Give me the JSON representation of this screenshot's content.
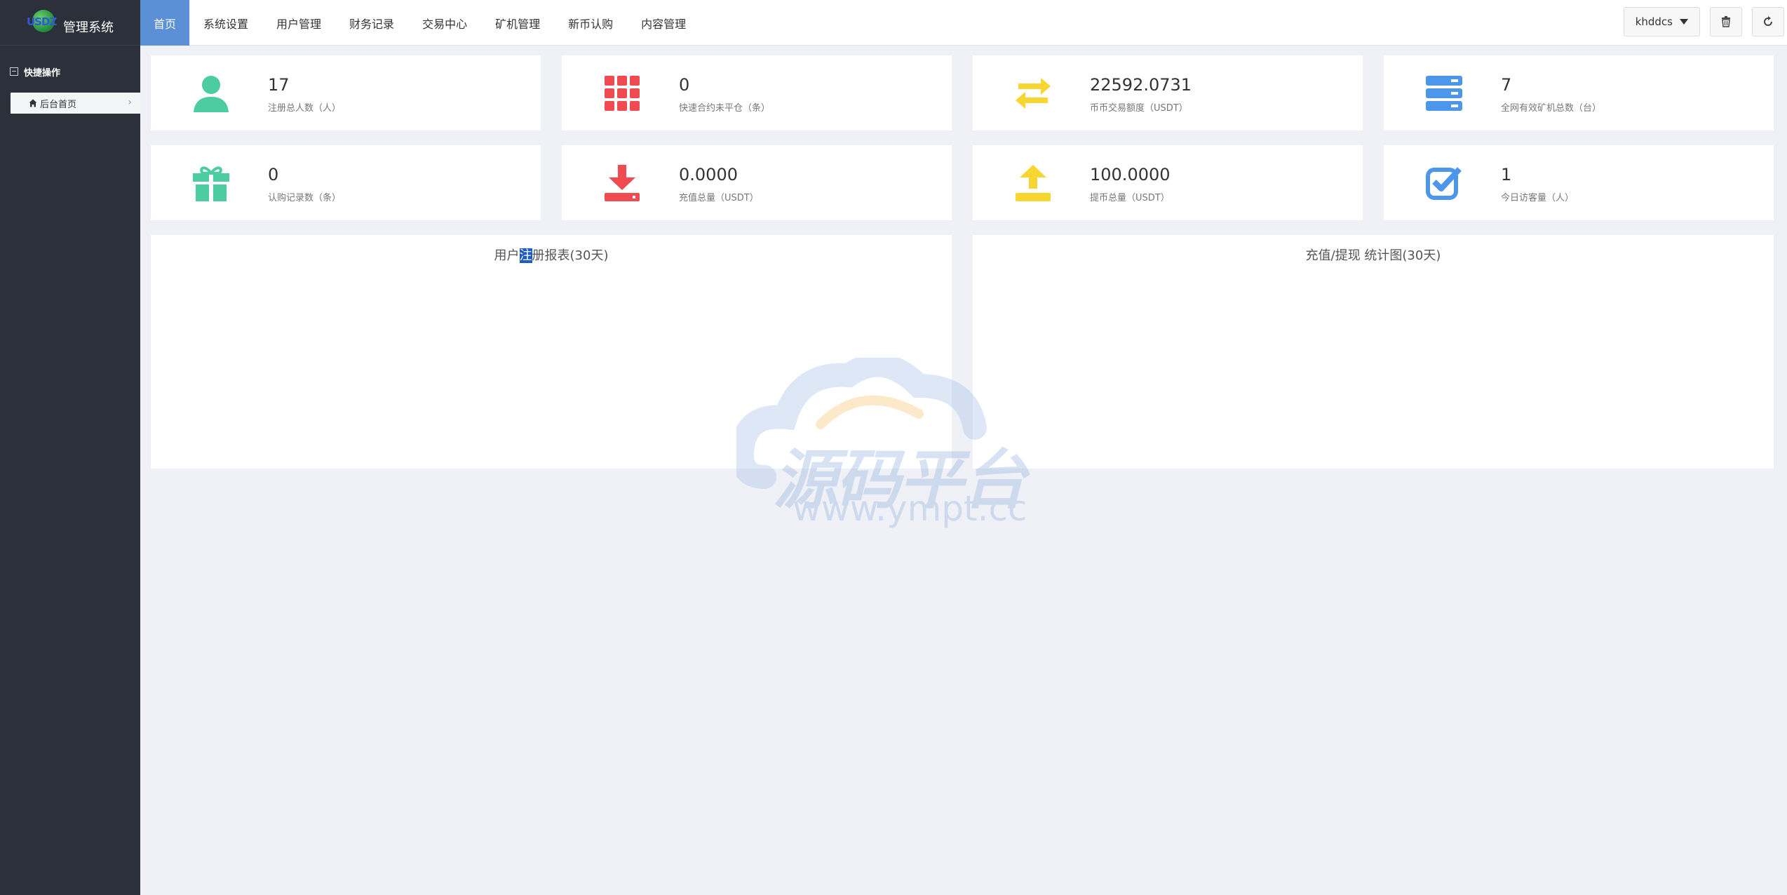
{
  "app": {
    "logo_text": "USDZ",
    "title": "管理系统"
  },
  "sidebar": {
    "section_label": "快捷操作",
    "items": [
      {
        "label": "后台首页"
      }
    ]
  },
  "nav": {
    "items": [
      {
        "label": "首页",
        "active": true
      },
      {
        "label": "系统设置"
      },
      {
        "label": "用户管理"
      },
      {
        "label": "财务记录"
      },
      {
        "label": "交易中心"
      },
      {
        "label": "矿机管理"
      },
      {
        "label": "新币认购"
      },
      {
        "label": "内容管理"
      }
    ]
  },
  "header": {
    "username": "khddcs",
    "icons": [
      "trash-icon",
      "refresh-icon"
    ]
  },
  "stats": [
    {
      "value": "17",
      "caption": "注册总人数（人）",
      "icon": "user-icon",
      "color": "#4ccca0"
    },
    {
      "value": "0",
      "caption": "快速合约未平仓（条）",
      "icon": "grid-icon",
      "color": "#ef4b50"
    },
    {
      "value": "22592.0731",
      "caption": "币币交易额度（USDT）",
      "icon": "exchange-icon",
      "color": "#f7d631"
    },
    {
      "value": "7",
      "caption": "全网有效矿机总数（台）",
      "icon": "server-icon",
      "color": "#4c96ec"
    },
    {
      "value": "0",
      "caption": "认购记录数（条）",
      "icon": "gift-icon",
      "color": "#4ccca0"
    },
    {
      "value": "0.0000",
      "caption": "充值总量（USDT）",
      "icon": "download-icon",
      "color": "#ef4b50"
    },
    {
      "value": "100.0000",
      "caption": "提币总量（USDT）",
      "icon": "upload-icon",
      "color": "#f7d631"
    },
    {
      "value": "1",
      "caption": "今日访客量（人）",
      "icon": "checkbox-icon",
      "color": "#4c96ec"
    }
  ],
  "panels": {
    "left": {
      "title_a": "用户",
      "title_hl": "注",
      "title_b": "册报表(30天)"
    },
    "right": {
      "title": "充值/提现 统计图(30天)"
    }
  },
  "watermark": {
    "text": "源码平台",
    "url": "www.ympt.cc"
  }
}
